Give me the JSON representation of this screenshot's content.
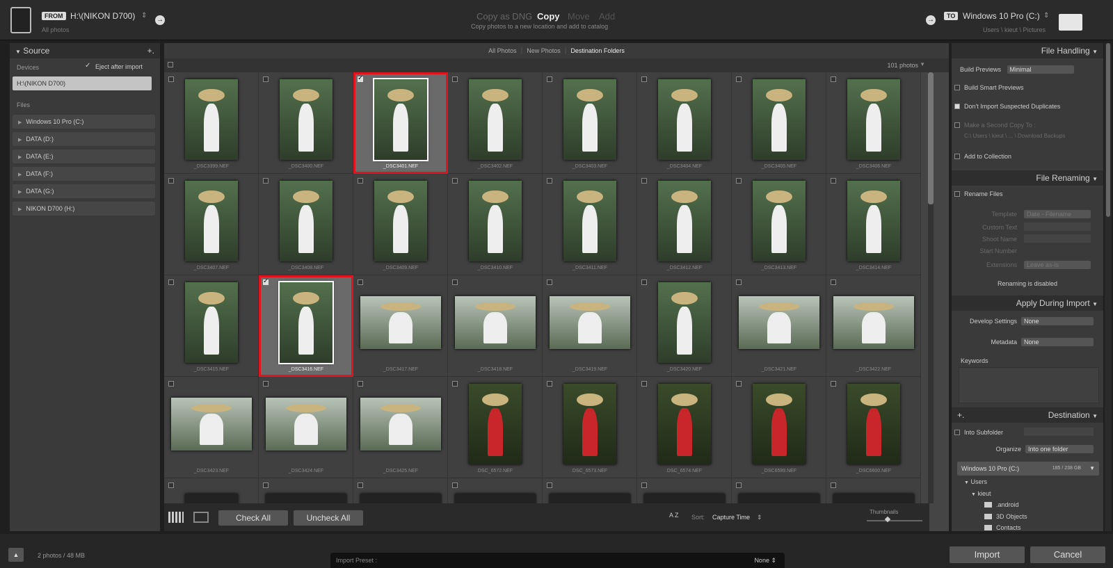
{
  "header": {
    "from_tag": "FROM",
    "source_name": "H:\\(NIKON D700)",
    "source_sub": "All photos",
    "modes": [
      "Copy as DNG",
      "Copy",
      "Move",
      "Add"
    ],
    "mode_desc": "Copy photos to a new location and add to catalog",
    "to_tag": "TO",
    "dest_name": "Windows 10 Pro (C:)",
    "dest_path": "Users \\ kieut \\ Pictures",
    "dropdown_glyph": "⇕"
  },
  "source": {
    "title": "Source",
    "add": "+.",
    "devices_label": "Devices",
    "eject_label": "Eject after import",
    "device_selected": "H:\\(NIKON D700)",
    "files_label": "Files",
    "drives": [
      "Windows 10 Pro (C:)",
      "DATA (D:)",
      "DATA (E:)",
      "DATA (F:)",
      "DATA (G:)",
      "NIKON D700 (H:)"
    ]
  },
  "grid": {
    "tabs": [
      "All Photos",
      "New Photos",
      "Destination Folders"
    ],
    "count": "101 photos",
    "photos": [
      {
        "name": "_DSC3399.NEF",
        "checked": false
      },
      {
        "name": "_DSC3400.NEF",
        "checked": false
      },
      {
        "name": "_DSC3401.NEF",
        "checked": true
      },
      {
        "name": "_DSC3402.NEF",
        "checked": false
      },
      {
        "name": "_DSC3403.NEF",
        "checked": false
      },
      {
        "name": "_DSC3404.NEF",
        "checked": false
      },
      {
        "name": "_DSC3405.NEF",
        "checked": false
      },
      {
        "name": "_DSC3406.NEF",
        "checked": false
      },
      {
        "name": "_DSC3407.NEF",
        "checked": false
      },
      {
        "name": "_DSC3408.NEF",
        "checked": false
      },
      {
        "name": "_DSC3409.NEF",
        "checked": false
      },
      {
        "name": "_DSC3410.NEF",
        "checked": false
      },
      {
        "name": "_DSC3411.NEF",
        "checked": false
      },
      {
        "name": "_DSC3412.NEF",
        "checked": false
      },
      {
        "name": "_DSC3413.NEF",
        "checked": false
      },
      {
        "name": "_DSC3414.NEF",
        "checked": false
      },
      {
        "name": "_DSC3415.NEF",
        "checked": false
      },
      {
        "name": "_DSC3416.NEF",
        "checked": true
      },
      {
        "name": "_DSC3417.NEF",
        "checked": false
      },
      {
        "name": "_DSC3418.NEF",
        "checked": false
      },
      {
        "name": "_DSC3419.NEF",
        "checked": false
      },
      {
        "name": "_DSC3420.NEF",
        "checked": false
      },
      {
        "name": "_DSC3421.NEF",
        "checked": false
      },
      {
        "name": "_DSC3422.NEF",
        "checked": false
      },
      {
        "name": "_DSC3423.NEF",
        "checked": false
      },
      {
        "name": "_DSC3424.NEF",
        "checked": false
      },
      {
        "name": "_DSC3425.NEF",
        "checked": false
      },
      {
        "name": "DSC_6572.NEF",
        "checked": false
      },
      {
        "name": "DSC_6573.NEF",
        "checked": false
      },
      {
        "name": "DSC_6574.NEF",
        "checked": false
      },
      {
        "name": "_DSC6599.NEF",
        "checked": false
      },
      {
        "name": "_DSC6600.NEF",
        "checked": false
      }
    ]
  },
  "toolbar": {
    "check_all": "Check All",
    "uncheck_all": "Uncheck All",
    "sort_label": "Sort:",
    "sort_value": "Capture Time",
    "sort_glyph": "⇕",
    "thumbnails_label": "Thumbnails",
    "az_glyph": "A Z"
  },
  "file_handling": {
    "title": "File Handling",
    "build_previews_label": "Build Previews",
    "build_previews_value": "Minimal",
    "smart_previews": "Build Smart Previews",
    "dont_import_dupes": "Don't Import Suspected Duplicates",
    "second_copy": "Make a Second Copy To :",
    "second_copy_path": "C:\\ Users \\ kieut \\ ... \\ Download Backups",
    "add_collection": "Add to Collection"
  },
  "file_renaming": {
    "title": "File Renaming",
    "rename_files": "Rename Files",
    "template_label": "Template",
    "template_value": "Date - Filename",
    "custom_text": "Custom Text",
    "shoot_name": "Shoot Name",
    "start_number": "Start Number",
    "extensions_label": "Extensions",
    "extensions_value": "Leave as-is",
    "status": "Renaming is disabled"
  },
  "apply_import": {
    "title": "Apply During Import",
    "develop_label": "Develop Settings",
    "develop_value": "None",
    "metadata_label": "Metadata",
    "metadata_value": "None",
    "keywords_label": "Keywords"
  },
  "destination": {
    "title": "Destination",
    "add": "+.",
    "into_subfolder": "Into Subfolder",
    "organize_label": "Organize",
    "organize_value": "Into one folder",
    "volume": "Windows 10 Pro (C:)",
    "volume_space": "185 / 238 GB",
    "tree": [
      "Users",
      "kieut",
      ".android",
      "3D Objects",
      "Contacts"
    ]
  },
  "footer": {
    "status": "2 photos / 48 MB",
    "preset_label": "Import Preset :",
    "preset_value": "None ⇕",
    "import": "Import",
    "cancel": "Cancel"
  }
}
